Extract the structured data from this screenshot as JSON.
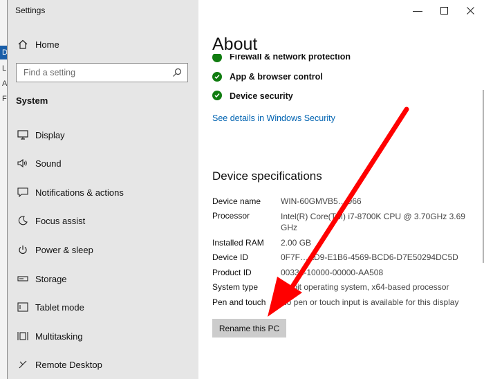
{
  "window": {
    "title": "Settings"
  },
  "sidebar": {
    "home_label": "Home",
    "search_placeholder": "Find a setting",
    "section_label": "System",
    "items": [
      {
        "label": "Display",
        "icon": "display-icon"
      },
      {
        "label": "Sound",
        "icon": "speaker-icon"
      },
      {
        "label": "Notifications & actions",
        "icon": "message-icon"
      },
      {
        "label": "Focus assist",
        "icon": "moon-icon"
      },
      {
        "label": "Power & sleep",
        "icon": "power-icon"
      },
      {
        "label": "Storage",
        "icon": "storage-icon"
      },
      {
        "label": "Tablet mode",
        "icon": "tablet-icon"
      },
      {
        "label": "Multitasking",
        "icon": "multitasking-icon"
      },
      {
        "label": "Remote Desktop",
        "icon": "remote-desktop-icon"
      }
    ]
  },
  "background_window": {
    "letters": [
      "D",
      "L",
      "A",
      "F"
    ]
  },
  "main": {
    "title": "About",
    "security_items": [
      "Firewall & network protection",
      "App & browser control",
      "Device security"
    ],
    "security_link": "See details in Windows Security",
    "spec_heading": "Device specifications",
    "specs": [
      {
        "key": "Device name",
        "value": "WIN-60GMVB5…D66"
      },
      {
        "key": "Processor",
        "value": "Intel(R) Core(TM) i7-8700K CPU @ 3.70GHz   3.69 GHz"
      },
      {
        "key": "Installed RAM",
        "value": "2.00 GB"
      },
      {
        "key": "Device ID",
        "value": "0F7F…AD9-E1B6-4569-BCD6-D7E50294DC5D"
      },
      {
        "key": "Product ID",
        "value": "00331-10000-00000-AA508"
      },
      {
        "key": "System type",
        "value": "64-bit operating system, x64-based processor"
      },
      {
        "key": "Pen and touch",
        "value": "No pen or touch input is available for this display"
      }
    ],
    "rename_button": "Rename this PC"
  },
  "colors": {
    "accent": "#0063b1",
    "check": "#107c10",
    "arrow": "#ff0000"
  }
}
